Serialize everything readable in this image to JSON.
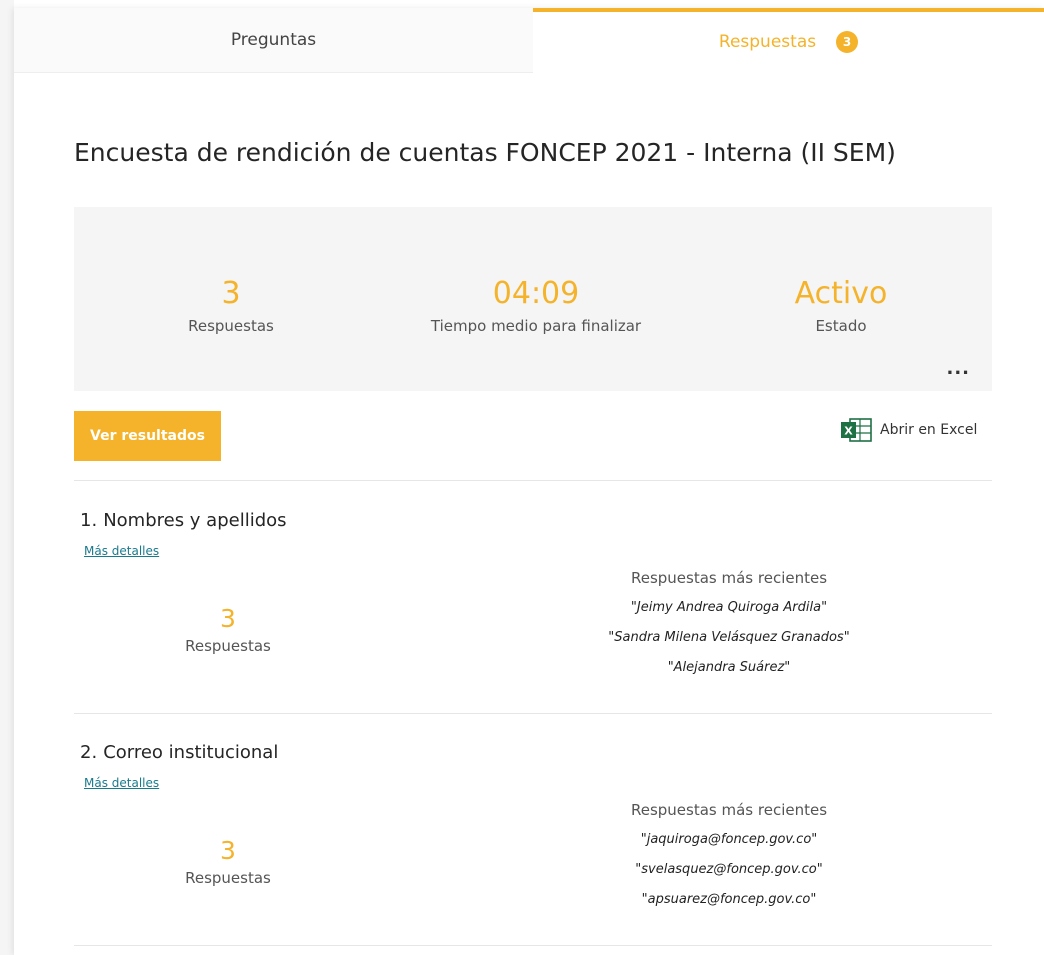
{
  "tabs": {
    "preguntas": "Preguntas",
    "respuestas": "Respuestas",
    "respuestas_badge": "3"
  },
  "form_title": "Encuesta de rendición de cuentas FONCEP 2021 - Interna (II SEM)",
  "summary": {
    "responses_count": "3",
    "responses_label": "Respuestas",
    "avg_time": "04:09",
    "avg_time_label": "Tiempo medio para finalizar",
    "status": "Activo",
    "status_label": "Estado",
    "more": "..."
  },
  "actions": {
    "view_results": "Ver resultados",
    "open_excel": "Abrir en Excel"
  },
  "questions": [
    {
      "number": "1.",
      "title": "Nombres y apellidos",
      "details_link": "Más detalles",
      "count": "3",
      "count_label": "Respuestas",
      "recent_header": "Respuestas más recientes",
      "recent": [
        "\"Jeimy Andrea Quiroga Ardila\"",
        "\"Sandra Milena Velásquez Granados\"",
        "\"Alejandra Suárez\""
      ]
    },
    {
      "number": "2.",
      "title": "Correo institucional",
      "details_link": "Más detalles",
      "count": "3",
      "count_label": "Respuestas",
      "recent_header": "Respuestas más recientes",
      "recent": [
        "\"jaquiroga@foncep.gov.co\"",
        "\"svelasquez@foncep.gov.co\"",
        "\"apsuarez@foncep.gov.co\""
      ]
    }
  ],
  "colors": {
    "accent": "#f4b32a",
    "excel_green": "#1e7145",
    "link": "#1a7a8c"
  }
}
